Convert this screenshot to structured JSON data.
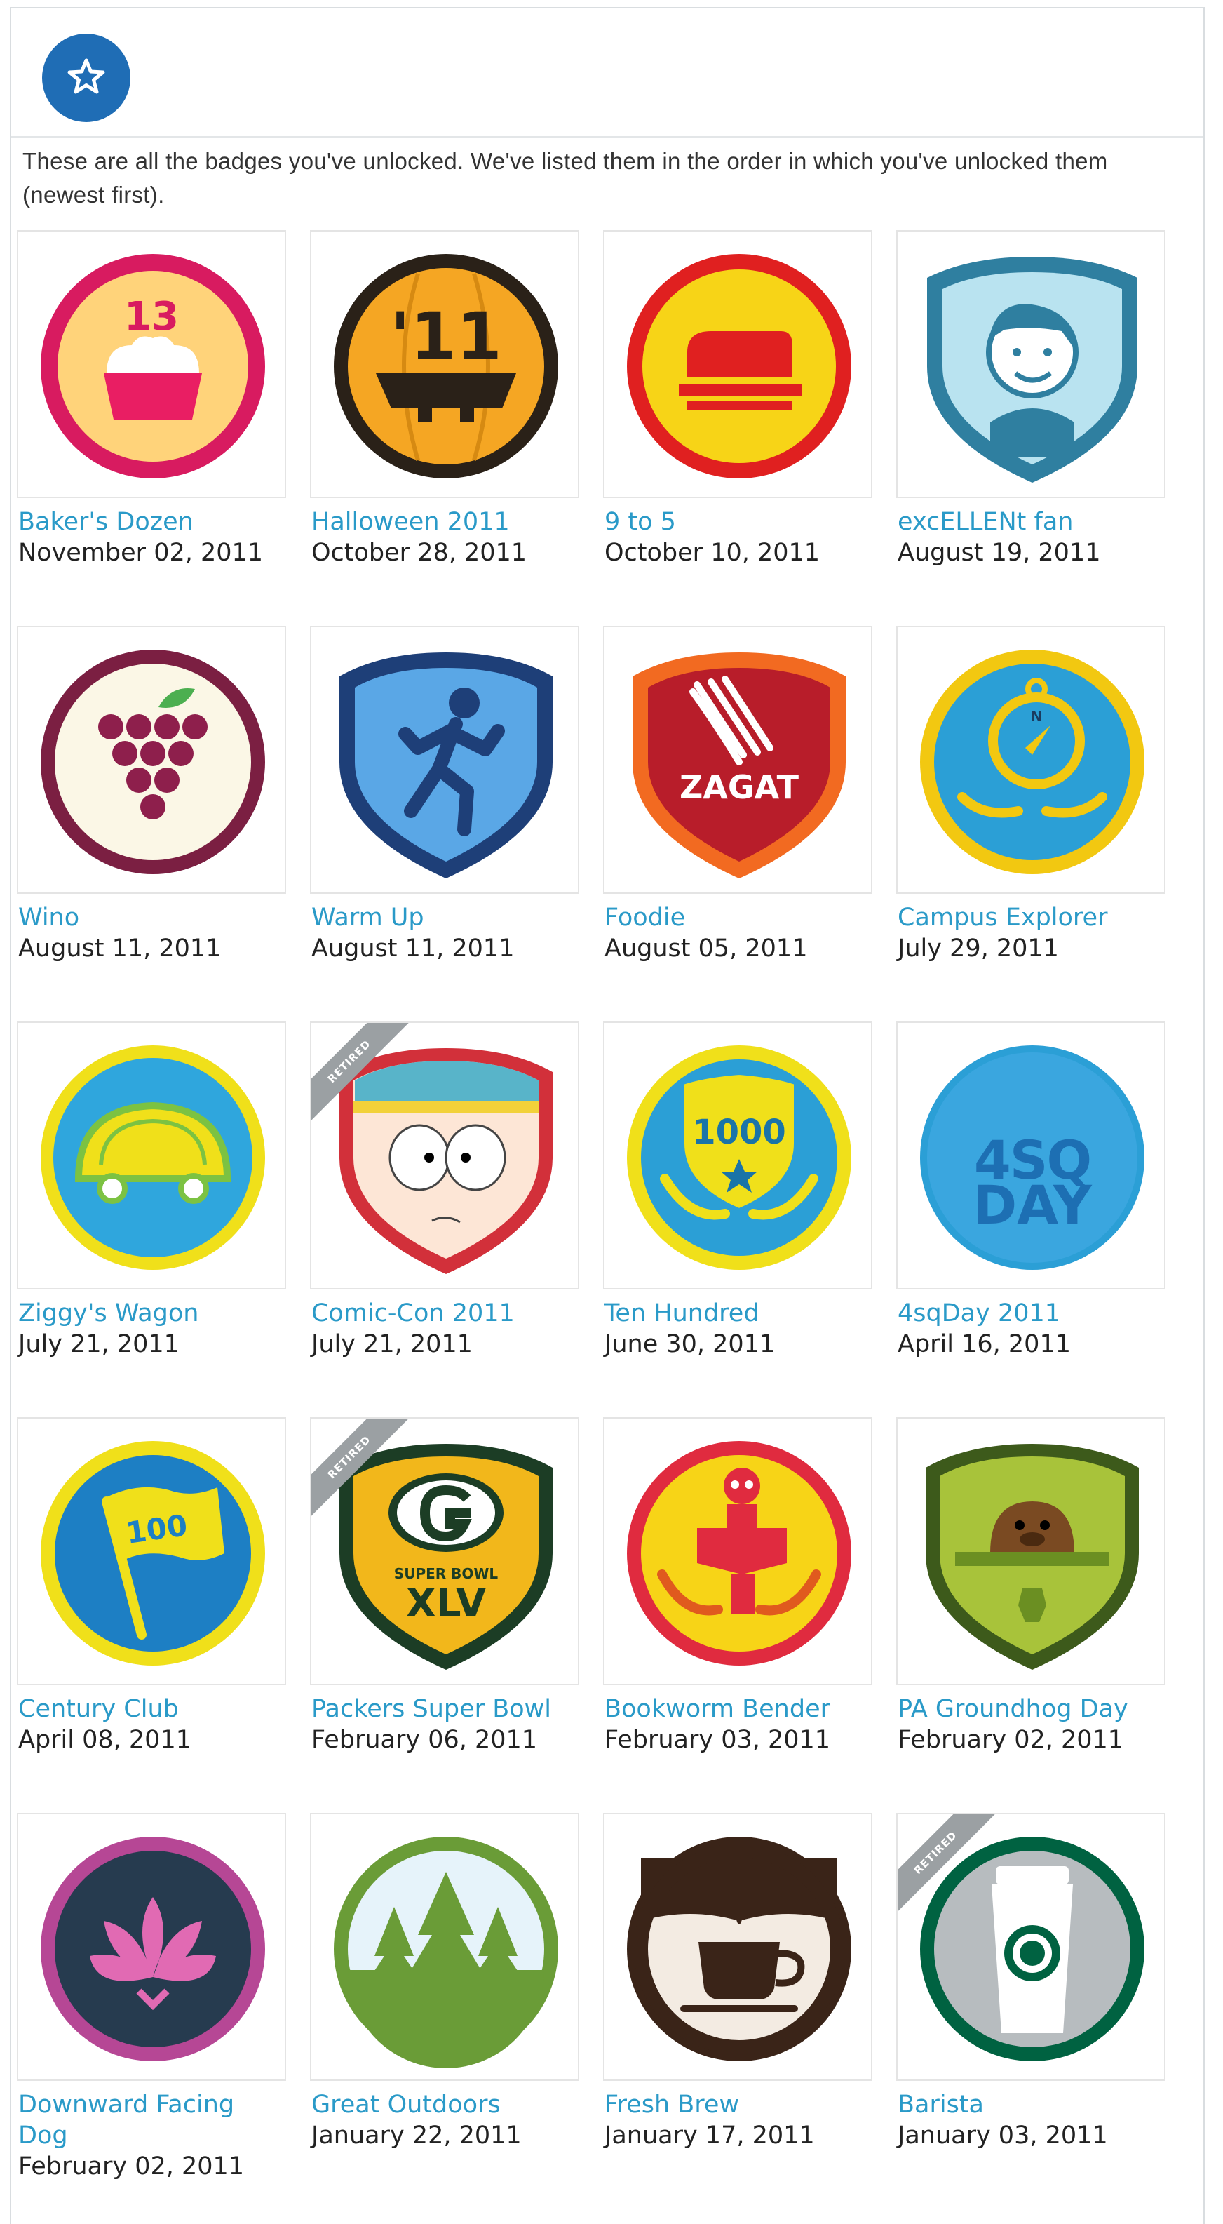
{
  "header": {
    "icon": "star-badge-icon",
    "accent": "#1f6db5"
  },
  "intro_text": "These are all the badges you've unlocked. We've listed them in the order in which you've unlocked them (newest first).",
  "retired_label": "RETIRED",
  "colors": {
    "name_link": "#2a9ac8",
    "date_text": "#222222",
    "tile_border": "#e4e4e4"
  },
  "badges": [
    {
      "name": "Baker's Dozen",
      "date": "November 02, 2011",
      "icon": "cupcake-icon",
      "badge_text": "13"
    },
    {
      "name": "Halloween 2011",
      "date": "October 28, 2011",
      "icon": "pumpkin-icon",
      "badge_text": "'11"
    },
    {
      "name": "9 to 5",
      "date": "October 10, 2011",
      "icon": "stapler-icon"
    },
    {
      "name": "excELLENt fan",
      "date": "August 19, 2011",
      "icon": "portrait-icon"
    },
    {
      "name": "Wino",
      "date": "August 11, 2011",
      "icon": "grapes-icon"
    },
    {
      "name": "Warm Up",
      "date": "August 11, 2011",
      "icon": "runner-icon"
    },
    {
      "name": "Foodie",
      "date": "August 05, 2011",
      "icon": "fork-icon",
      "badge_text": "ZAGAT"
    },
    {
      "name": "Campus Explorer",
      "date": "July 29, 2011",
      "icon": "compass-icon",
      "badge_text": "N"
    },
    {
      "name": "Ziggy's Wagon",
      "date": "July 21, 2011",
      "icon": "taco-wagon-icon"
    },
    {
      "name": "Comic-Con 2011",
      "date": "July 21, 2011",
      "icon": "cartoon-face-icon",
      "retired": true
    },
    {
      "name": "Ten Hundred",
      "date": "June 30, 2011",
      "icon": "shield-laurel-icon",
      "badge_text": "1000"
    },
    {
      "name": "4sqDay 2011",
      "date": "April 16, 2011",
      "icon": "4sqday-icon",
      "badge_text": "4SQ DAY"
    },
    {
      "name": "Century Club",
      "date": "April 08, 2011",
      "icon": "flag-icon",
      "badge_text": "100"
    },
    {
      "name": "Packers Super Bowl",
      "date": "February 06, 2011",
      "icon": "football-shield-icon",
      "badge_text": "XLV",
      "badge_text2": "SUPER BOWL",
      "retired": true
    },
    {
      "name": "Bookworm Bender",
      "date": "February 03, 2011",
      "icon": "bookworm-icon"
    },
    {
      "name": "PA Groundhog Day",
      "date": "February 02, 2011",
      "icon": "groundhog-icon"
    },
    {
      "name": "Downward Facing Dog",
      "date": "February 02, 2011",
      "icon": "lotus-icon",
      "two_line": true
    },
    {
      "name": "Great Outdoors",
      "date": "January 22, 2011",
      "icon": "trees-icon"
    },
    {
      "name": "Fresh Brew",
      "date": "January 17, 2011",
      "icon": "coffee-cup-icon"
    },
    {
      "name": "Barista",
      "date": "January 03, 2011",
      "icon": "takeaway-cup-icon",
      "retired": true
    }
  ]
}
